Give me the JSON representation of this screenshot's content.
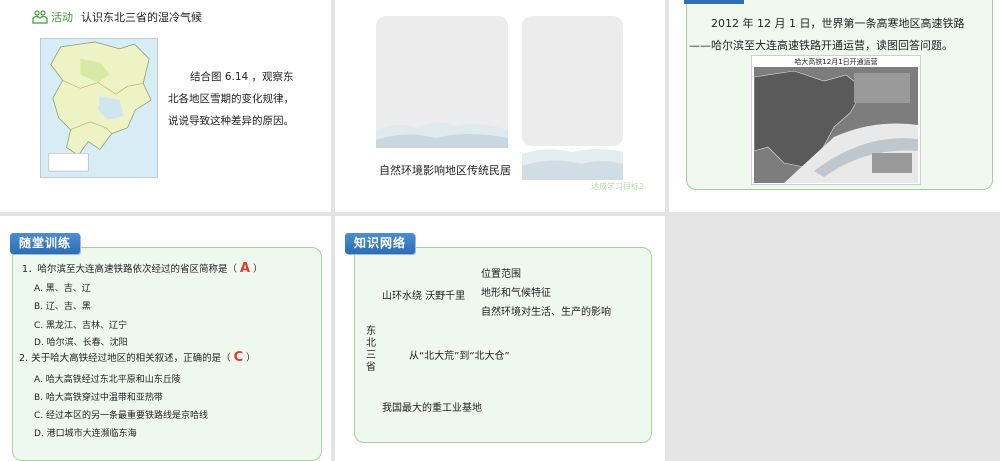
{
  "slide1": {
    "activity_label": "活动",
    "activity_title": "认识东北三省的湿冷气候",
    "text": "结合图 6.14 ，观察东北各地区雪期的变化规律，说说导致这种差异的原因。"
  },
  "slide2": {
    "caption": "自然环境影响地区传统民居",
    "watermark": "达成学习目标2"
  },
  "slide3": {
    "text": "2012 年 12 月 1 日，世界第一条高寒地区高速铁路——哈尔滨至大连高速铁路开通运营，读图回答问题。",
    "photo_title": "哈大高铁12月1日开通运营"
  },
  "slide4": {
    "badge": "随堂训练",
    "q1": {
      "text": "1．哈尔滨至大连高速铁路依次经过的省区简称是（",
      "answer": "A",
      "close": "）",
      "options": [
        "A. 黑、吉、辽",
        "B. 辽、吉、黑",
        "C. 黑龙江、吉林、辽宁",
        "D. 哈尔滨、长春、沈阳"
      ]
    },
    "q2": {
      "text": "2. 关于哈大高铁经过地区的相关叙述，正确的是（",
      "answer": "C",
      "close": "）",
      "options": [
        "A. 哈大高铁经过东北平原和山东丘陵",
        "B. 哈大高铁穿过中温带和亚热带",
        "C. 经过本区的另一条最重要铁路线是京哈线",
        "D. 港口城市大连濒临东海"
      ]
    }
  },
  "slide5": {
    "badge": "知识网络",
    "center": "东北三省",
    "item1": "山环水绕 沃野千里",
    "sub1": "位置范围",
    "sub2": "地形和气候特征",
    "sub3": "自然环境对生活、生产的影响",
    "item2": "从“北大荒”到“北大仓”",
    "item3": "我国最大的重工业基地"
  }
}
